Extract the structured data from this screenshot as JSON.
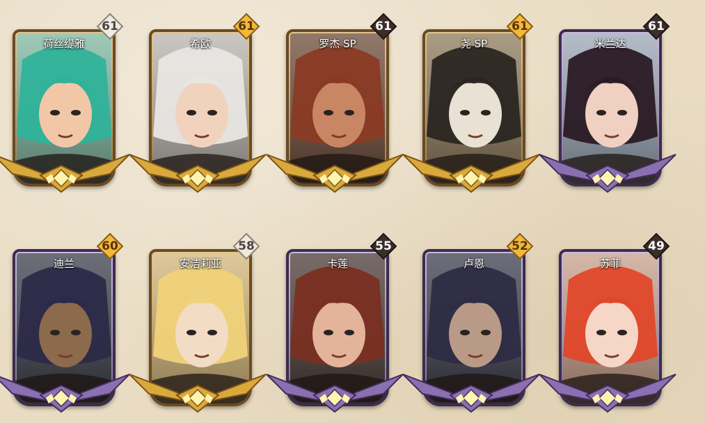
{
  "heroes": [
    {
      "name": "荷丝缇雅",
      "level": "61",
      "badge": "silver",
      "rank": "gold",
      "hair": "#2fb29a",
      "skin": "#f2c7a8",
      "bg": "#7fb7a0"
    },
    {
      "name": "希欧",
      "level": "61",
      "badge": "gold",
      "rank": "gold",
      "hair": "#e8e6e2",
      "skin": "#f1d2bc",
      "bg": "#b9b4ad"
    },
    {
      "name": "罗杰 SP",
      "level": "61",
      "badge": "dark",
      "rank": "gold",
      "hair": "#8a3a24",
      "skin": "#c98664",
      "bg": "#6d4b38"
    },
    {
      "name": "尧 SP",
      "level": "61",
      "badge": "gold",
      "rank": "gold",
      "hair": "#2b2622",
      "skin": "#e9e1d3",
      "bg": "#8e7a5a"
    },
    {
      "name": "米兰达",
      "level": "61",
      "badge": "dark",
      "rank": "purple",
      "hair": "#2a1b25",
      "skin": "#f0d0c0",
      "bg": "#9aa6b6"
    },
    {
      "name": "迪兰",
      "level": "60",
      "badge": "gold",
      "rank": "purple",
      "hair": "#2c2a48",
      "skin": "#8c6a4c",
      "bg": "#3b3f4a"
    },
    {
      "name": "安洁莉亚",
      "level": "58",
      "badge": "silver",
      "rank": "gold",
      "hair": "#f0d27a",
      "skin": "#f2dcc4",
      "bg": "#d3b77a"
    },
    {
      "name": "卡莲",
      "level": "55",
      "badge": "dark",
      "rank": "purple",
      "hair": "#7a2f22",
      "skin": "#e3b49a",
      "bg": "#4b3a36"
    },
    {
      "name": "卢恩",
      "level": "52",
      "badge": "gold",
      "rank": "purple",
      "hair": "#2e2c46",
      "skin": "#b99a86",
      "bg": "#3c3d4c"
    },
    {
      "name": "苏菲",
      "level": "49",
      "badge": "dark",
      "rank": "purple",
      "hair": "#e0482a",
      "skin": "#f6d6c6",
      "bg": "#c9a08a"
    }
  ]
}
